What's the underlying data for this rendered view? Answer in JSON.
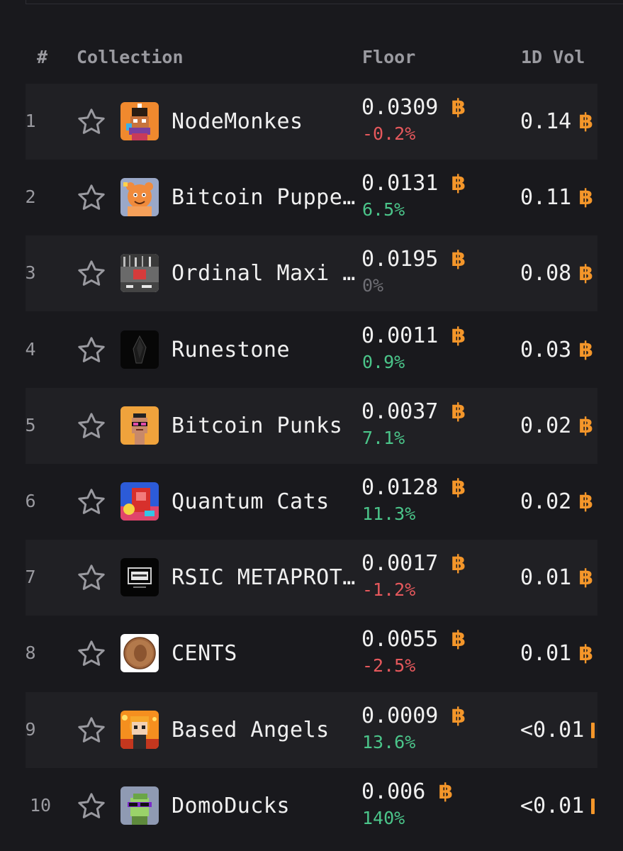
{
  "header": {
    "rank": "#",
    "collection": "Collection",
    "floor": "Floor",
    "volume": "1D Vol"
  },
  "currency_symbol": "฿",
  "colors": {
    "background": "#19191d",
    "row_alt": "#202024",
    "bitcoin": "#f4962a",
    "positive": "#4bc58a",
    "negative": "#e5585c",
    "neutral": "#6e6e74"
  },
  "rows": [
    {
      "rank": "1",
      "name": "NodeMonkes",
      "floor": "0.0309",
      "change": "-0.2%",
      "trend": "negative",
      "volume": "0.14"
    },
    {
      "rank": "2",
      "name": "Bitcoin Puppe…",
      "floor": "0.0131",
      "change": "6.5%",
      "trend": "positive",
      "volume": "0.11"
    },
    {
      "rank": "3",
      "name": "Ordinal Maxi …",
      "floor": "0.0195",
      "change": "0%",
      "trend": "neutral",
      "volume": "0.08"
    },
    {
      "rank": "4",
      "name": "Runestone",
      "floor": "0.0011",
      "change": "0.9%",
      "trend": "positive",
      "volume": "0.03"
    },
    {
      "rank": "5",
      "name": "Bitcoin Punks",
      "floor": "0.0037",
      "change": "7.1%",
      "trend": "positive",
      "volume": "0.02"
    },
    {
      "rank": "6",
      "name": "Quantum Cats",
      "floor": "0.0128",
      "change": "11.3%",
      "trend": "positive",
      "volume": "0.02"
    },
    {
      "rank": "7",
      "name": "RSIC METAPROT…",
      "floor": "0.0017",
      "change": "-1.2%",
      "trend": "negative",
      "volume": "0.01"
    },
    {
      "rank": "8",
      "name": "CENTS",
      "floor": "0.0055",
      "change": "-2.5%",
      "trend": "negative",
      "volume": "0.01"
    },
    {
      "rank": "9",
      "name": "Based Angels",
      "floor": "0.0009",
      "change": "13.6%",
      "trend": "positive",
      "volume": "<0.01"
    },
    {
      "rank": "10",
      "name": "DomoDucks",
      "floor": "0.006",
      "change": "140%",
      "trend": "positive",
      "volume": "<0.01"
    }
  ]
}
